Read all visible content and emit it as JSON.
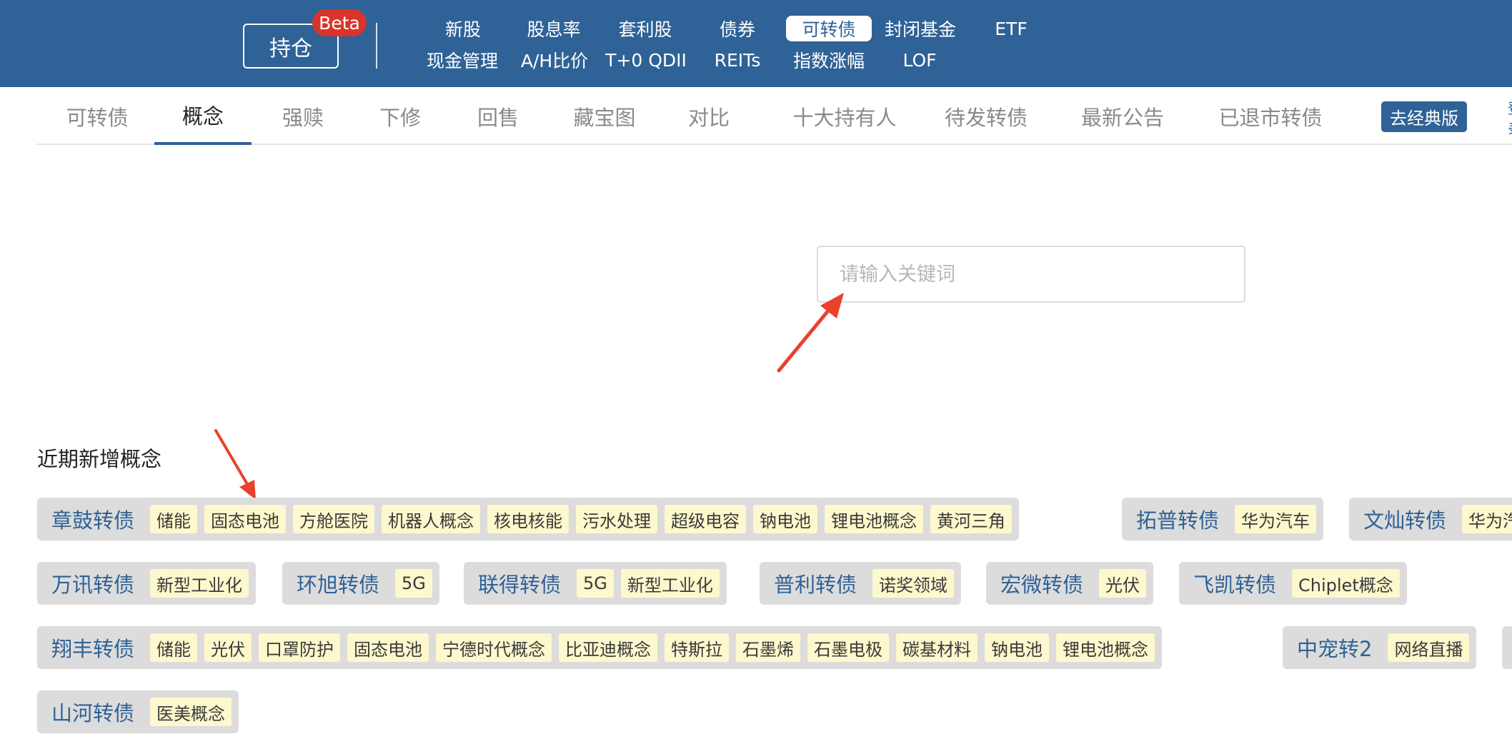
{
  "header": {
    "holdings_label": "持仓",
    "beta_label": "Beta",
    "nav_row1": [
      "新股",
      "股息率",
      "套利股",
      "债券",
      "可转债",
      "封闭基金",
      "ETF"
    ],
    "nav_row2": [
      "现金管理",
      "A/H比价",
      "T+0 QDII",
      "REITs",
      "指数涨幅",
      "LOF"
    ],
    "active_nav": "可转债"
  },
  "tabs": [
    "可转债",
    "概念",
    "强赎",
    "下修",
    "回售",
    "藏宝图",
    "对比",
    "十大持有人",
    "待发转债",
    "最新公告",
    "已退市转债"
  ],
  "active_tab": "概念",
  "classic_button": "去经典版",
  "search": {
    "placeholder": "请输入关键词",
    "value": ""
  },
  "section_title": "近期新增概念",
  "groups": [
    {
      "bond": "章鼓转债",
      "tags": [
        "储能",
        "固态电池",
        "方舱医院",
        "机器人概念",
        "核电核能",
        "污水处理",
        "超级电容",
        "钠电池",
        "锂电池概念",
        "黄河三角"
      ]
    },
    {
      "bond": "拓普转债",
      "tags": [
        "华为汽车"
      ]
    },
    {
      "bond": "文灿转债",
      "tags": [
        "华为汽车"
      ]
    },
    {
      "bond": "万讯转债",
      "tags": [
        "新型工业化"
      ]
    },
    {
      "bond": "环旭转债",
      "tags": [
        "5G"
      ]
    },
    {
      "bond": "联得转债",
      "tags": [
        "5G",
        "新型工业化"
      ]
    },
    {
      "bond": "普利转债",
      "tags": [
        "诺奖领域"
      ]
    },
    {
      "bond": "宏微转债",
      "tags": [
        "光伏"
      ]
    },
    {
      "bond": "飞凯转债",
      "tags": [
        "Chiplet概念"
      ]
    },
    {
      "bond": "翔丰转债",
      "tags": [
        "储能",
        "光伏",
        "口罩防护",
        "固态电池",
        "宁德时代概念",
        "比亚迪概念",
        "特斯拉",
        "石墨烯",
        "石墨电极",
        "碳基材料",
        "钠电池",
        "锂电池概念"
      ]
    },
    {
      "bond": "中宠转2",
      "tags": [
        "网络直播"
      ]
    },
    {
      "bond": "山河转债",
      "tags": [
        "医美概念"
      ]
    }
  ],
  "colors": {
    "header_bg": "#2f6296",
    "beta_badge": "#d9342b",
    "bond_name": "#2f6296",
    "tag_bg": "#fdf8cd",
    "group_bg": "#dcdcdc",
    "annotation_arrow": "#e8412d"
  }
}
